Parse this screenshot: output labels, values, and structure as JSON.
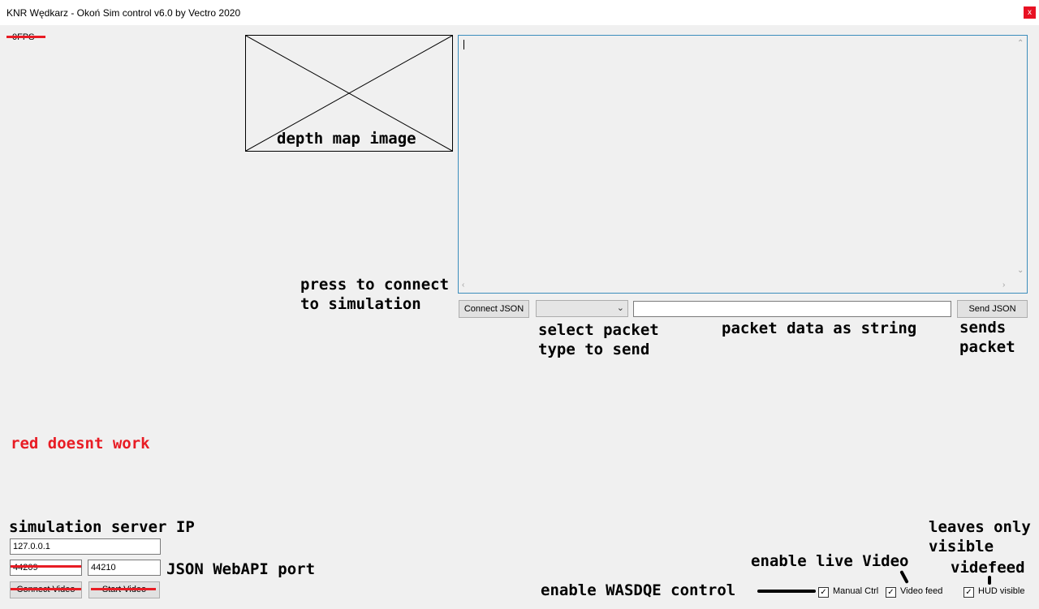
{
  "window": {
    "title": "KNR Wędkarz - Okoń Sim control v6.0 by Vectro 2020",
    "close_glyph": "x"
  },
  "fps_label": "0FPS",
  "depth_map": {
    "caption": "depth map image"
  },
  "json_output": {
    "value": ""
  },
  "controls": {
    "connect_json_label": "Connect JSON",
    "packet_type_value": "",
    "packet_data_value": "",
    "send_json_label": "Send JSON",
    "server_ip_value": "127.0.0.1",
    "video_port_value": "44209",
    "json_port_value": "44210",
    "connect_video_label": "Connect Video",
    "start_video_label": "Start Video",
    "manual_ctrl_label": "Manual Ctrl",
    "video_feed_label": "Video feed",
    "hud_visible_label": "HUD visible",
    "check_glyph": "✓"
  },
  "annotations": {
    "press_connect_1": "press to connect",
    "press_connect_2": "to simulation",
    "select_packet_1": "select packet",
    "select_packet_2": "type to send",
    "packet_data": "packet data as string",
    "sends_1": "sends",
    "sends_2": "packet",
    "red_note": "red doesnt work",
    "server_ip": "simulation server IP",
    "json_port": "JSON WebAPI port",
    "enable_live_video": "enable live Video",
    "leaves_1": "leaves only",
    "leaves_2": "visible",
    "leaves_3": "videfeed",
    "wasdqe": "enable WASDQE control"
  },
  "colors": {
    "annotation_red": "#e81c24",
    "output_border": "#3c8dbc",
    "close_red": "#e81123"
  }
}
